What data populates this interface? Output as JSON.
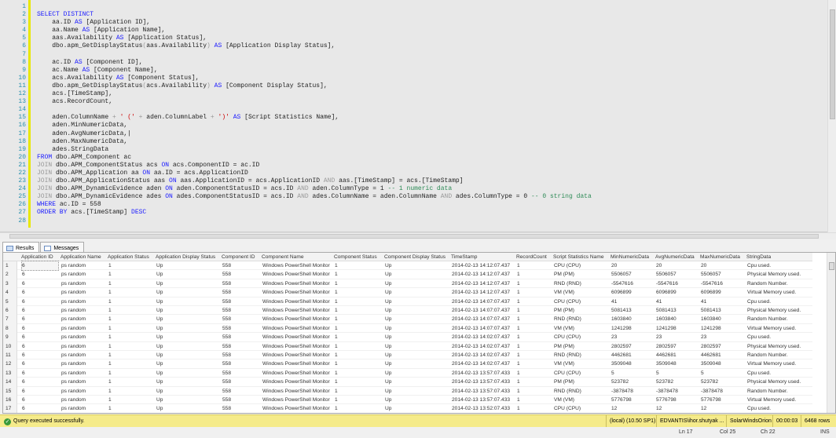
{
  "editor": {
    "lines": [
      [],
      [
        [
          "kw",
          "SELECT DISTINCT"
        ]
      ],
      [
        [
          "",
          "    aa.ID "
        ],
        [
          "kw",
          "AS"
        ],
        [
          "",
          " [Application ID],"
        ]
      ],
      [
        [
          "",
          "    aa.Name "
        ],
        [
          "kw",
          "AS"
        ],
        [
          "",
          " [Application Name],"
        ]
      ],
      [
        [
          "",
          "    aas.Availability "
        ],
        [
          "kw",
          "AS"
        ],
        [
          "",
          " [Application Status],"
        ]
      ],
      [
        [
          "",
          "    dbo.apm_GetDisplayStatus"
        ],
        [
          "op",
          "("
        ],
        [
          "",
          "aas.Availability"
        ],
        [
          "op",
          ")"
        ],
        [
          "",
          " "
        ],
        [
          "kw",
          "AS"
        ],
        [
          "",
          " [Application Display Status],"
        ]
      ],
      [],
      [
        [
          "",
          "    ac.ID "
        ],
        [
          "kw",
          "AS"
        ],
        [
          "",
          " [Component ID],"
        ]
      ],
      [
        [
          "",
          "    ac.Name "
        ],
        [
          "kw",
          "AS"
        ],
        [
          "",
          " [Component Name],"
        ]
      ],
      [
        [
          "",
          "    acs.Availability "
        ],
        [
          "kw",
          "AS"
        ],
        [
          "",
          " [Component Status],"
        ]
      ],
      [
        [
          "",
          "    dbo.apm_GetDisplayStatus"
        ],
        [
          "op",
          "("
        ],
        [
          "",
          "acs.Availability"
        ],
        [
          "op",
          ")"
        ],
        [
          "",
          " "
        ],
        [
          "kw",
          "AS"
        ],
        [
          "",
          " [Component Display Status],"
        ]
      ],
      [
        [
          "",
          "    acs.[TimeStamp],"
        ]
      ],
      [
        [
          "",
          "    acs.RecordCount,"
        ]
      ],
      [],
      [
        [
          "",
          "    aden.ColumnName "
        ],
        [
          "op",
          "+"
        ],
        [
          "",
          " "
        ],
        [
          "st",
          "' ('"
        ],
        [
          "",
          " "
        ],
        [
          "op",
          "+"
        ],
        [
          "",
          " aden.ColumnLabel "
        ],
        [
          "op",
          "+"
        ],
        [
          "",
          " "
        ],
        [
          "st",
          "')'"
        ],
        [
          "",
          " "
        ],
        [
          "kw",
          "AS"
        ],
        [
          "",
          " [Script Statistics Name],"
        ]
      ],
      [
        [
          "",
          "    aden.MinNumericData,"
        ]
      ],
      [
        [
          "",
          "    aden.AvgNumericData,|"
        ]
      ],
      [
        [
          "",
          "    aden.MaxNumericData,"
        ]
      ],
      [
        [
          "",
          "    ades.StringData"
        ]
      ],
      [
        [
          "kw",
          "FROM"
        ],
        [
          "",
          " dbo.APM_Component ac"
        ]
      ],
      [
        [
          "op",
          "JOIN"
        ],
        [
          "",
          " dbo.APM_ComponentStatus acs "
        ],
        [
          "kw",
          "ON"
        ],
        [
          "",
          " acs.ComponentID = ac.ID"
        ]
      ],
      [
        [
          "op",
          "JOIN"
        ],
        [
          "",
          " dbo.APM_Application aa "
        ],
        [
          "kw",
          "ON"
        ],
        [
          "",
          " aa.ID = acs.ApplicationID"
        ]
      ],
      [
        [
          "op",
          "JOIN"
        ],
        [
          "",
          " dbo.APM_ApplicationStatus aas "
        ],
        [
          "kw",
          "ON"
        ],
        [
          "",
          " aas.ApplicationID = acs.ApplicationID "
        ],
        [
          "op",
          "AND"
        ],
        [
          "",
          " aas.[TimeStamp] = acs.[TimeStamp]"
        ]
      ],
      [
        [
          "op",
          "JOIN"
        ],
        [
          "",
          " dbo.APM_DynamicEvidence aden "
        ],
        [
          "kw",
          "ON"
        ],
        [
          "",
          " aden.ComponentStatusID = acs.ID "
        ],
        [
          "op",
          "AND"
        ],
        [
          "",
          " aden.ColumnType = 1 "
        ],
        [
          "cm",
          "-- 1 numeric data"
        ]
      ],
      [
        [
          "op",
          "JOIN"
        ],
        [
          "",
          " dbo.APM_DynamicEvidence ades "
        ],
        [
          "kw",
          "ON"
        ],
        [
          "",
          " ades.ComponentStatusID = acs.ID "
        ],
        [
          "op",
          "AND"
        ],
        [
          "",
          " ades.ColumnName = aden.ColumnName "
        ],
        [
          "op",
          "AND"
        ],
        [
          "",
          " ades.ColumnType = 0 "
        ],
        [
          "cm",
          "-- 0 string data"
        ]
      ],
      [
        [
          "kw",
          "WHERE"
        ],
        [
          "",
          " ac.ID = 558"
        ]
      ],
      [
        [
          "kw",
          "ORDER BY"
        ],
        [
          "",
          " acs.[TimeStamp] "
        ],
        [
          "kw",
          "DESC"
        ]
      ],
      []
    ]
  },
  "tabs": {
    "results": "Results",
    "messages": "Messages"
  },
  "grid": {
    "columns": [
      "Application ID",
      "Application Name",
      "Application Status",
      "Application Display Status",
      "Component ID",
      "Component Name",
      "Component Status",
      "Component Display Status",
      "TimeStamp",
      "RecordCount",
      "Script Statistics Name",
      "MinNumericData",
      "AvgNumericData",
      "MaxNumericData",
      "StringData"
    ],
    "rows": [
      [
        "1",
        "6",
        "ps random",
        "1",
        "Up",
        "558",
        "Windows PowerShell Monitor",
        "1",
        "Up",
        "2014-02-13 14:12:07.437",
        "1",
        "CPU (CPU)",
        "20",
        "20",
        "20",
        "Cpu used."
      ],
      [
        "2",
        "6",
        "ps random",
        "1",
        "Up",
        "558",
        "Windows PowerShell Monitor",
        "1",
        "Up",
        "2014-02-13 14:12:07.437",
        "1",
        "PM (PM)",
        "5506057",
        "5506057",
        "5506057",
        "Physical Memory used."
      ],
      [
        "3",
        "6",
        "ps random",
        "1",
        "Up",
        "558",
        "Windows PowerShell Monitor",
        "1",
        "Up",
        "2014-02-13 14:12:07.437",
        "1",
        "RND (RND)",
        "-5547616",
        "-5547616",
        "-5547616",
        "Random Number."
      ],
      [
        "4",
        "6",
        "ps random",
        "1",
        "Up",
        "558",
        "Windows PowerShell Monitor",
        "1",
        "Up",
        "2014-02-13 14:12:07.437",
        "1",
        "VM (VM)",
        "6096899",
        "6096899",
        "6096899",
        "Virtual Memory used."
      ],
      [
        "5",
        "6",
        "ps random",
        "1",
        "Up",
        "558",
        "Windows PowerShell Monitor",
        "1",
        "Up",
        "2014-02-13 14:07:07.437",
        "1",
        "CPU (CPU)",
        "41",
        "41",
        "41",
        "Cpu used."
      ],
      [
        "6",
        "6",
        "ps random",
        "1",
        "Up",
        "558",
        "Windows PowerShell Monitor",
        "1",
        "Up",
        "2014-02-13 14:07:07.437",
        "1",
        "PM (PM)",
        "5081413",
        "5081413",
        "5081413",
        "Physical Memory used."
      ],
      [
        "7",
        "6",
        "ps random",
        "1",
        "Up",
        "558",
        "Windows PowerShell Monitor",
        "1",
        "Up",
        "2014-02-13 14:07:07.437",
        "1",
        "RND (RND)",
        "1603840",
        "1603840",
        "1603840",
        "Random Number."
      ],
      [
        "8",
        "6",
        "ps random",
        "1",
        "Up",
        "558",
        "Windows PowerShell Monitor",
        "1",
        "Up",
        "2014-02-13 14:07:07.437",
        "1",
        "VM (VM)",
        "1241298",
        "1241298",
        "1241298",
        "Virtual Memory used."
      ],
      [
        "9",
        "6",
        "ps random",
        "1",
        "Up",
        "558",
        "Windows PowerShell Monitor",
        "1",
        "Up",
        "2014-02-13 14:02:07.437",
        "1",
        "CPU (CPU)",
        "23",
        "23",
        "23",
        "Cpu used."
      ],
      [
        "10",
        "6",
        "ps random",
        "1",
        "Up",
        "558",
        "Windows PowerShell Monitor",
        "1",
        "Up",
        "2014-02-13 14:02:07.437",
        "1",
        "PM (PM)",
        "2802597",
        "2802597",
        "2802597",
        "Physical Memory used."
      ],
      [
        "11",
        "6",
        "ps random",
        "1",
        "Up",
        "558",
        "Windows PowerShell Monitor",
        "1",
        "Up",
        "2014-02-13 14:02:07.437",
        "1",
        "RND (RND)",
        "4462681",
        "4462681",
        "4462681",
        "Random Number."
      ],
      [
        "12",
        "6",
        "ps random",
        "1",
        "Up",
        "558",
        "Windows PowerShell Monitor",
        "1",
        "Up",
        "2014-02-13 14:02:07.437",
        "1",
        "VM (VM)",
        "3509048",
        "3509048",
        "3509048",
        "Virtual Memory used."
      ],
      [
        "13",
        "6",
        "ps random",
        "1",
        "Up",
        "558",
        "Windows PowerShell Monitor",
        "1",
        "Up",
        "2014-02-13 13:57:07.433",
        "1",
        "CPU (CPU)",
        "5",
        "5",
        "5",
        "Cpu used."
      ],
      [
        "14",
        "6",
        "ps random",
        "1",
        "Up",
        "558",
        "Windows PowerShell Monitor",
        "1",
        "Up",
        "2014-02-13 13:57:07.433",
        "1",
        "PM (PM)",
        "523782",
        "523782",
        "523782",
        "Physical Memory used."
      ],
      [
        "15",
        "6",
        "ps random",
        "1",
        "Up",
        "558",
        "Windows PowerShell Monitor",
        "1",
        "Up",
        "2014-02-13 13:57:07.433",
        "1",
        "RND (RND)",
        "-3878478",
        "-3878478",
        "-3878478",
        "Random Number."
      ],
      [
        "16",
        "6",
        "ps random",
        "1",
        "Up",
        "558",
        "Windows PowerShell Monitor",
        "1",
        "Up",
        "2014-02-13 13:57:07.433",
        "1",
        "VM (VM)",
        "5776798",
        "5776798",
        "5776798",
        "Virtual Memory used."
      ],
      [
        "17",
        "6",
        "ps random",
        "1",
        "Up",
        "558",
        "Windows PowerShell Monitor",
        "1",
        "Up",
        "2014-02-13 13:52:07.433",
        "1",
        "CPU (CPU)",
        "12",
        "12",
        "12",
        "Cpu used."
      ]
    ]
  },
  "status": {
    "message": "Query executed successfully.",
    "server": "(local) (10.50 SP1)",
    "user": "EDVANTIS\\ihor.shutyak ...",
    "database": "SolarWindsOrion",
    "elapsed": "00:00:03",
    "rows": "6468 rows"
  },
  "bottom": {
    "ln": "Ln 17",
    "col": "Col 25",
    "ch": "Ch 22",
    "mode": "INS"
  }
}
